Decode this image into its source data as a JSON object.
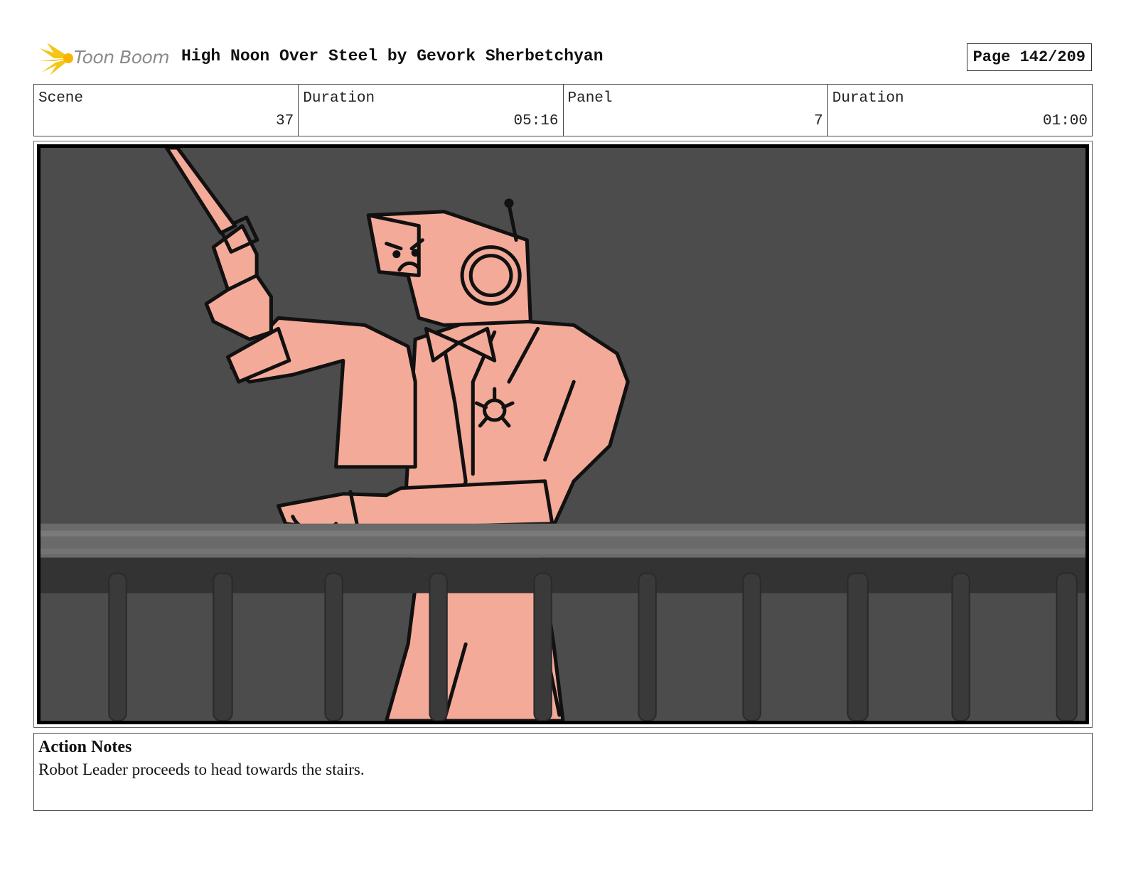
{
  "header": {
    "logo_text": "Toon Boom",
    "title": "High Noon Over Steel by Gevork Sherbetchyan",
    "page": "Page 142/209"
  },
  "info": {
    "scene_label": "Scene",
    "scene_value": "37",
    "scene_duration_label": "Duration",
    "scene_duration_value": "05:16",
    "panel_label": "Panel",
    "panel_value": "7",
    "panel_duration_label": "Duration",
    "panel_duration_value": "01:00"
  },
  "notes": {
    "title": "Action Notes",
    "text": "Robot Leader proceeds to head towards the stairs."
  },
  "colors": {
    "robot_fill": "#f4aa98",
    "background": "#4c4c4c",
    "logo_yellow": "#f5c518"
  },
  "icons": {
    "logo": "toon-boom-starburst-icon"
  }
}
